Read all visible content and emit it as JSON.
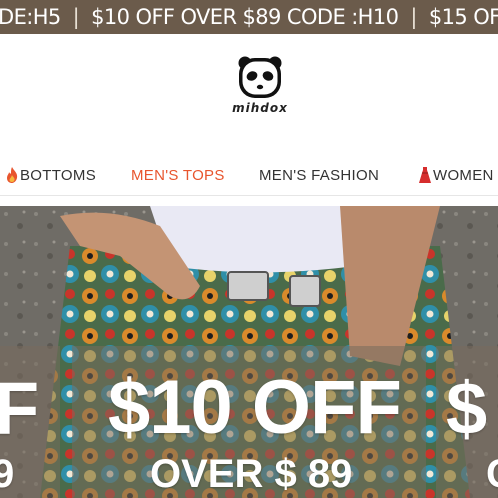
{
  "promo_bar": {
    "items": [
      "DE:H5",
      "$10 OFF OVER $89 CODE :H10",
      "$15 OF"
    ],
    "separator": "|"
  },
  "brand": {
    "name": "mihdox",
    "logo_icon": "panda-icon"
  },
  "nav": {
    "items": [
      {
        "label": "BOTTOMS",
        "icon": "flame-icon",
        "active": false
      },
      {
        "label": "MEN'S TOPS",
        "active": true
      },
      {
        "label": "MEN'S FASHION",
        "active": false
      },
      {
        "label": "WOMEN",
        "icon": "dress-icon",
        "active": false
      }
    ]
  },
  "hero": {
    "left": {
      "headline": "F",
      "subline": "9"
    },
    "center": {
      "headline": "$10 OFF",
      "subline": "OVER $ 89"
    },
    "right": {
      "headline": "$",
      "subline": "C"
    }
  },
  "colors": {
    "promo_bg": "#6b5b4b",
    "nav_active": "#e8552e",
    "panel": "#786c5c"
  }
}
